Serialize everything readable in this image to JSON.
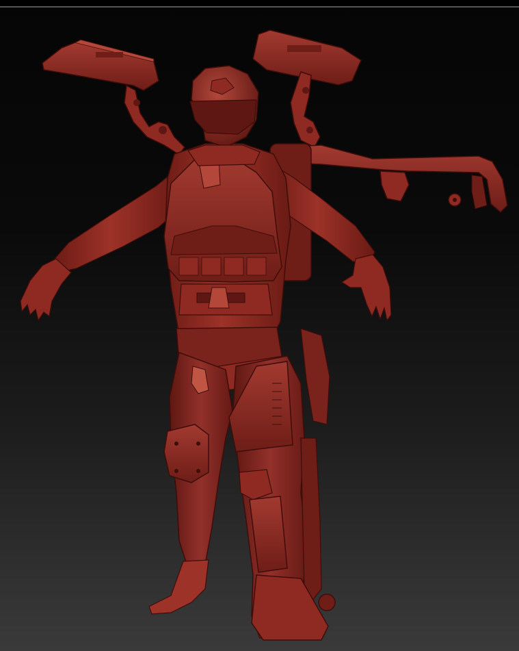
{
  "viewport": {
    "background_top": "#050505",
    "background_bottom": "#3a3a3a",
    "border_color": "#555555"
  },
  "model": {
    "subject": "armored-soldier-sculpt",
    "material_colors": {
      "base": "#8e2a22",
      "shade": "#5e1712",
      "highlight": "#b2473a",
      "dark": "#3e0d0a"
    }
  }
}
